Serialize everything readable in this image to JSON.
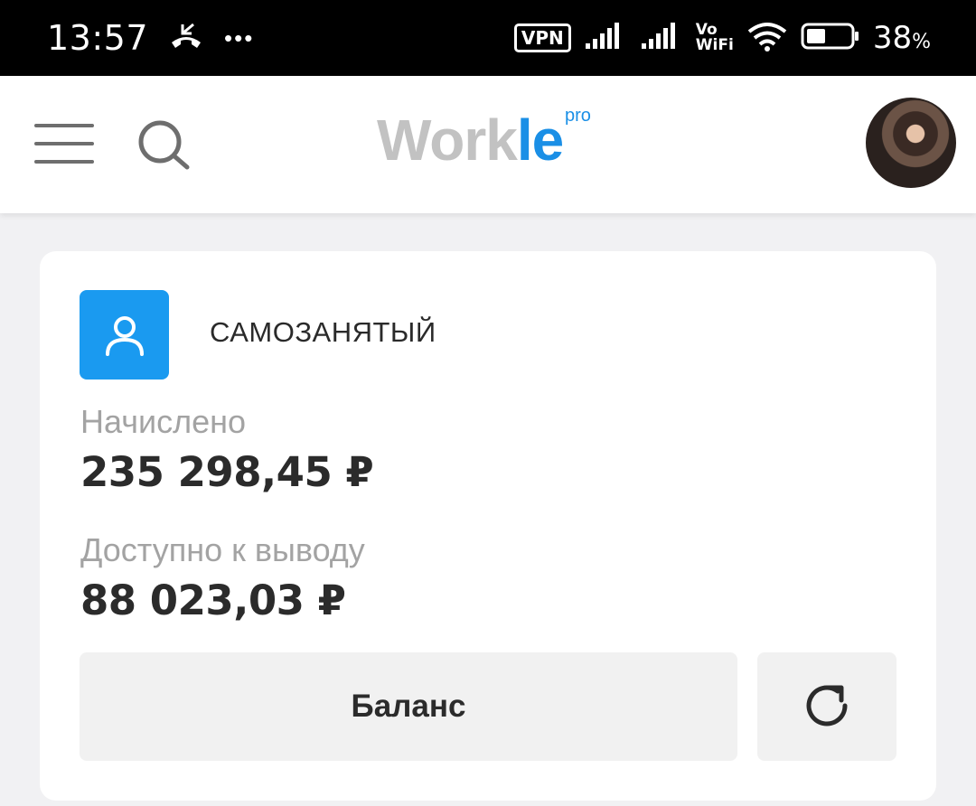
{
  "status_bar": {
    "time": "13:57",
    "notification_dots": "•••",
    "vpn_label": "VPN",
    "vowifi_top": "Vo",
    "vowifi_bottom": "WiFi",
    "battery_value": "38",
    "battery_unit": "%",
    "icons": [
      "missed-call-icon",
      "signal-icon",
      "signal-icon",
      "wifi-icon",
      "battery-icon"
    ]
  },
  "header": {
    "logo_work": "Work",
    "logo_le": "le",
    "logo_pro": "pro",
    "icons": [
      "hamburger-menu-icon",
      "search-icon"
    ]
  },
  "card": {
    "account_type": "САМОЗАНЯТЫЙ",
    "accrued_label": "Начислено",
    "accrued_value": "235 298,45 ₽",
    "available_label": "Доступно к выводу",
    "available_value": "88 023,03 ₽",
    "balance_button": "Баланс",
    "icons": [
      "user-icon",
      "refresh-icon"
    ]
  },
  "colors": {
    "accent": "#1a9af0",
    "logo_gray": "#c2c2c2",
    "background": "#f1f1f3"
  }
}
